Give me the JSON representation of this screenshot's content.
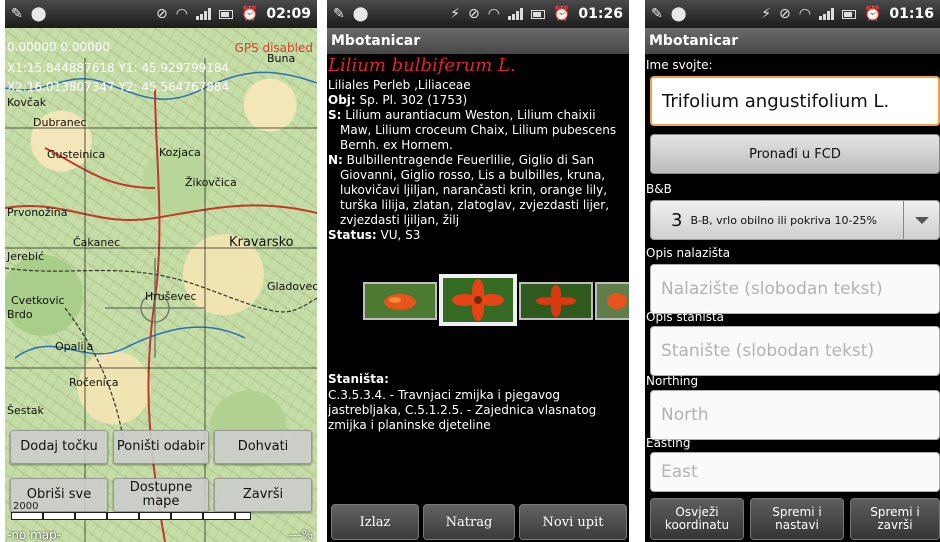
{
  "status_bars": {
    "p1_time": "02:09",
    "p2_time": "01:26",
    "p3_time": "01:16"
  },
  "map_screen": {
    "coords": "0.00000 0.00000",
    "gps_status": "GPS disabled",
    "x1y1": "X1:15.844887618 Y1: 45.929799184",
    "x2y2": "X2:16.013807347 Y2: 45.564767884",
    "buttons": {
      "add_point": "Dodaj točku",
      "cancel_selection": "Poništi odabir",
      "fetch": "Dohvati",
      "delete_all": "Obriši sve",
      "available_maps": "Dostupne mape",
      "finish": "Završi"
    },
    "scale_label": "2000",
    "bottom_left": "-no map-",
    "bottom_right": "---%",
    "place_labels": [
      "Dubranec",
      "Gusteinica",
      "Kozjaca",
      "Žikovčica",
      "Prvonožina",
      "Kravarsko",
      "Čakanec",
      "Jerebić",
      "Cvetkovic",
      "Hruševec",
      "Gladovec",
      "Opalija",
      "Ročenica",
      "Šestak",
      "Brdo",
      "Buna",
      "Kovčak"
    ]
  },
  "detail_screen": {
    "app_title": "Mbotanicar",
    "species": "Lilium bulbiferum L.",
    "family": "Liliales Perleb ,Liliaceae",
    "obj_label": "Obj:",
    "obj_value": " Sp. Pl. 302 (1753)",
    "s_label": "S:",
    "s_value": " Lilium aurantiacum Weston, Lilium chaixii Maw, Lilium croceum Chaix, Lilium pubescens Bernh. ex Hornem.",
    "n_label": "N:",
    "n_value": " Bulbillentragende Feuerlilie, Giglio di San Giovanni, Giglio rosso, Lis a bulbilles, kruna, lukovičavi ljiljan, narančasti krin, orange lily, turška lilija, zlatan, zlatoglav, zvjezdasti lijer, zvjezdasti ljiljan, žilj",
    "status_label": "Status:",
    "status_value": " VU, S3",
    "habitats_label": "Staništa:",
    "habitats_text": " C.3.5.3.4. - Travnjaci zmijka i pjegavog jastrebljaka, C.5.1.2.5. - Zajednica vlasnatog zmijka i planinske djeteline",
    "buttons": {
      "exit": "Izlaz",
      "back": "Natrag",
      "new_query": "Novi upit"
    }
  },
  "form_screen": {
    "app_title": "Mbotanicar",
    "taxon_label": "Ime svojte:",
    "taxon_value": "Trifolium angustifolium L.",
    "find_button": "Pronađi u FCD",
    "bb_label": "B&B",
    "bb_number": "3",
    "bb_text": "B-B, vrlo obilno ili pokriva 10-25%",
    "location_label": "Opis nalazišta",
    "location_placeholder": "Nalazište (slobodan tekst)",
    "habitat_label": "Opis staništa",
    "habitat_placeholder": "Stanište (slobodan tekst)",
    "northing_label": "Northing",
    "northing_placeholder": "North",
    "easting_label": "Easting",
    "easting_placeholder": "East",
    "buttons": {
      "refresh": "Osvježi koordinatu",
      "save_continue": "Spremi i nastavi",
      "save_finish": "Spremi i završi"
    }
  }
}
